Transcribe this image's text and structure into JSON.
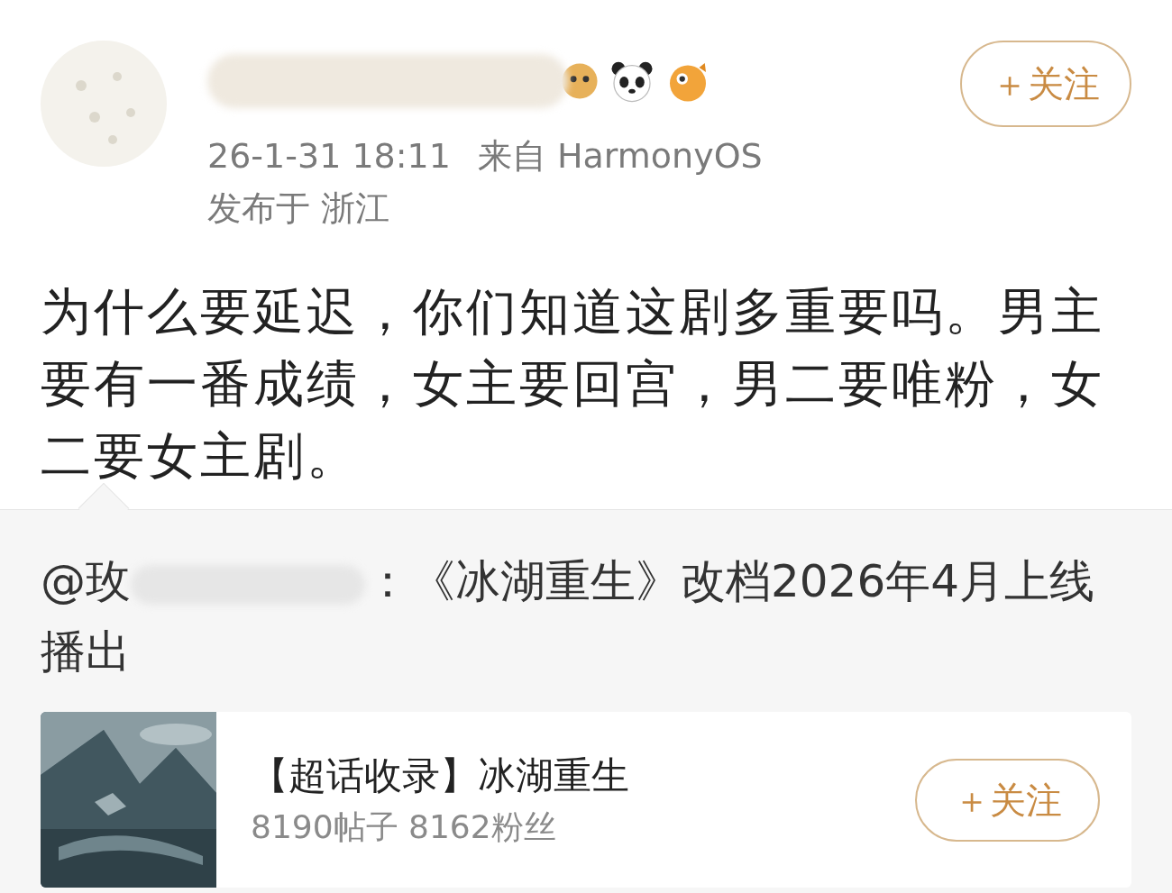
{
  "post": {
    "timestamp": "26-1-31 18:11",
    "source": "来自 HarmonyOS",
    "location": "发布于 浙江",
    "follow_button": {
      "label": "＋关注"
    },
    "text": "为什么要延迟，你们知道这剧多重要吗。男主要有一番成绩，女主要回宫，男二要唯粉，女二要女主剧。"
  },
  "repost": {
    "author_visible": "@玫",
    "text": "：《冰湖重生》改档2026年4月上线播出",
    "topic_card": {
      "title": "【超话收录】冰湖重生",
      "stats": "8190帖子 8162粉丝",
      "follow_button": {
        "label": "＋关注"
      }
    }
  }
}
